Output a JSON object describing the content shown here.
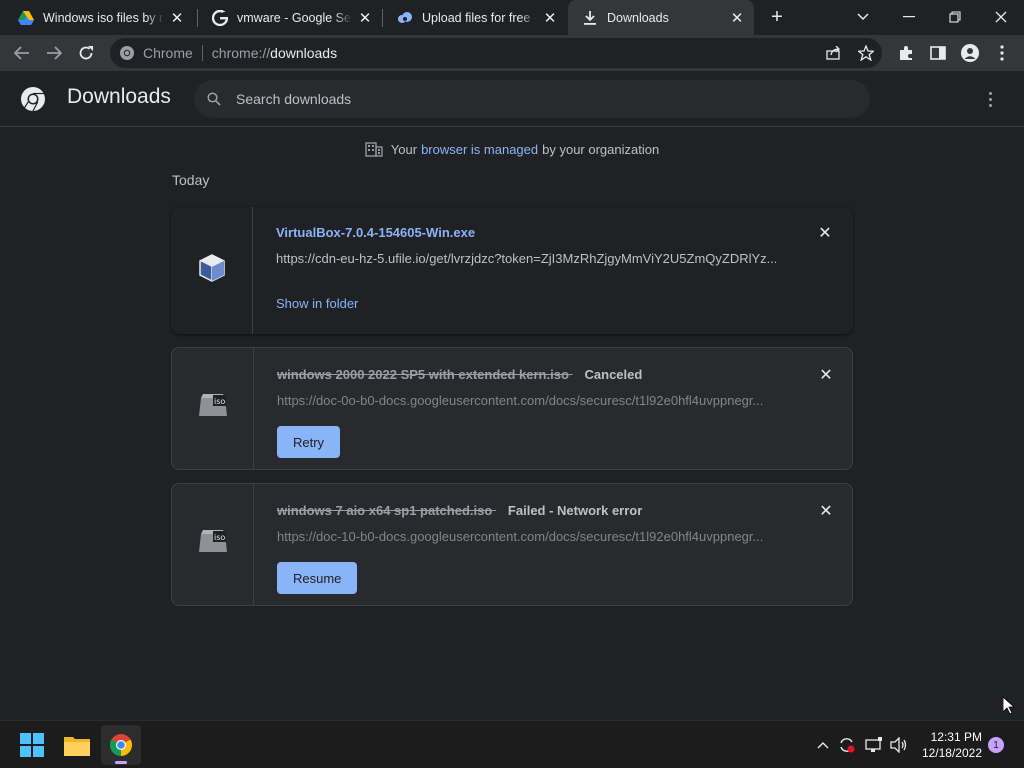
{
  "browser": {
    "tabs": [
      {
        "title": "Windows iso files by m",
        "favicon": "google-drive-icon"
      },
      {
        "title": "vmware - Google Search",
        "favicon": "google-g-icon"
      },
      {
        "title": "Upload files for free - V",
        "favicon": "ufile-cloud-icon"
      },
      {
        "title": "Downloads",
        "favicon": "download-arrow-icon"
      }
    ],
    "active_tab": 3,
    "omnibox": {
      "chip": "Chrome",
      "url_scheme": "chrome://",
      "url_path": "downloads"
    }
  },
  "downloads_page": {
    "title": "Downloads",
    "search_placeholder": "Search downloads",
    "managed": {
      "prefix": "Your",
      "link": "browser is managed",
      "suffix": "by your organization"
    },
    "section_label": "Today",
    "items": [
      {
        "filename": "VirtualBox-7.0.4-154605-Win.exe",
        "url": "https://cdn-eu-hz-5.ufile.io/get/lvrzjdzc?token=ZjI3MzRhZjgyMmViY2U5ZmQyZDRlYz...",
        "status": "",
        "action": "Show in folder",
        "icon": "virtualbox-icon"
      },
      {
        "filename": "windows 2000 2022 SP5 with extended kern.iso",
        "url": "https://doc-0o-b0-docs.googleusercontent.com/docs/securesc/t1l92e0hfl4uvppnegr...",
        "status": "Canceled",
        "action": "Retry",
        "icon": "iso-file-icon"
      },
      {
        "filename": "windows 7 aio x64 sp1 patched.iso",
        "url": "https://doc-10-b0-docs.googleusercontent.com/docs/securesc/t1l92e0hfl4uvppnegr...",
        "status": "Failed - Network error",
        "action": "Resume",
        "icon": "iso-file-icon"
      }
    ]
  },
  "taskbar": {
    "time": "12:31 PM",
    "date": "12/18/2022",
    "notification_count": "1"
  },
  "colors": {
    "accent_link": "#8ab4f8",
    "background": "#202124",
    "toolbar": "#35363a"
  }
}
